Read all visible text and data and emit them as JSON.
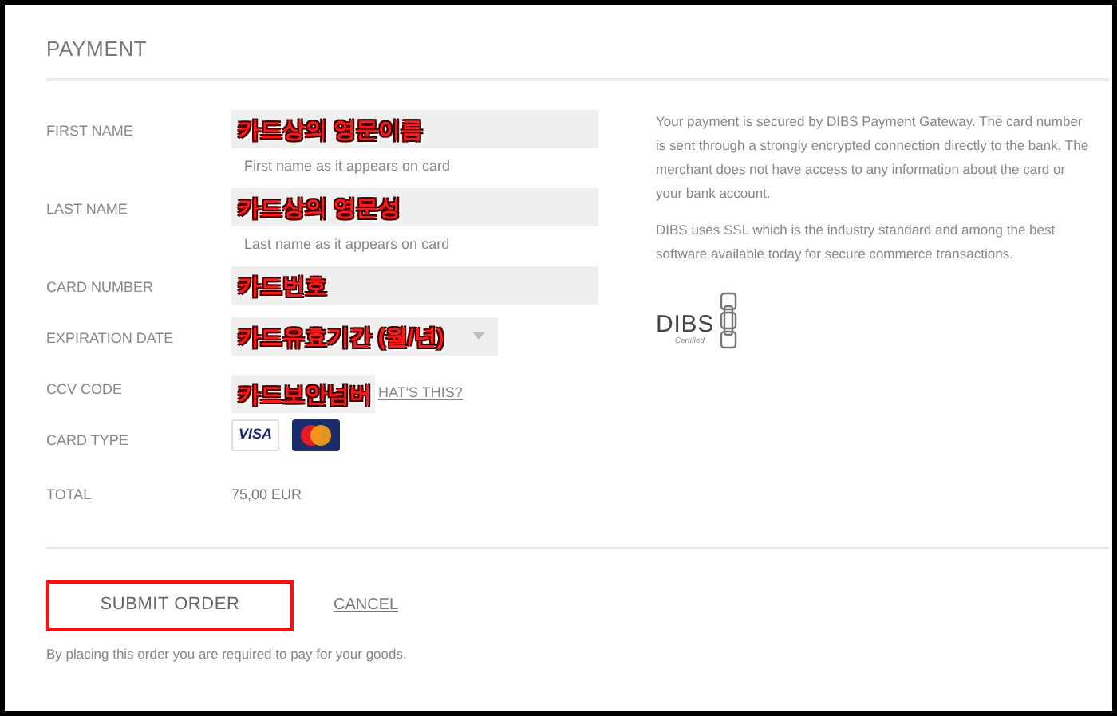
{
  "title": "PAYMENT",
  "fields": [
    {
      "kind": "text",
      "label": "FIRST NAME",
      "annotation": "카드상의 영문이름",
      "hint": "First name as it appears on card"
    },
    {
      "kind": "text",
      "label": "LAST NAME",
      "annotation": "카드상의 영문성",
      "hint": "Last name as it appears on card"
    },
    {
      "kind": "text",
      "label": "CARD NUMBER",
      "annotation": "카드번호"
    },
    {
      "kind": "date",
      "label": "EXPIRATION DATE",
      "annotation": "카드유효기간 (월/년)"
    },
    {
      "kind": "ccv",
      "label": "CCV CODE",
      "annotation": "카드보안넘버",
      "link": "HAT'S THIS?"
    },
    {
      "kind": "cards",
      "label": "CARD TYPE",
      "cards": [
        {
          "kind": "visa",
          "text": "VISA"
        },
        {
          "kind": "mastercard"
        }
      ]
    },
    {
      "kind": "total",
      "label": "TOTAL",
      "value": "75,00 EUR"
    }
  ],
  "info": [
    "Your payment is secured by DIBS Payment Gateway. The card number is sent through a strongly encrypted connection directly to the bank. The merchant does not have access to any information about the card or your bank account.",
    "DIBS uses SSL which is the industry standard and among the best software available today for secure commerce transactions."
  ],
  "logo": {
    "name": "DIBS",
    "caption": "Certified"
  },
  "submit": "SUBMIT ORDER",
  "cancel": "CANCEL",
  "footnote": "By placing this order you are required to pay for your goods."
}
